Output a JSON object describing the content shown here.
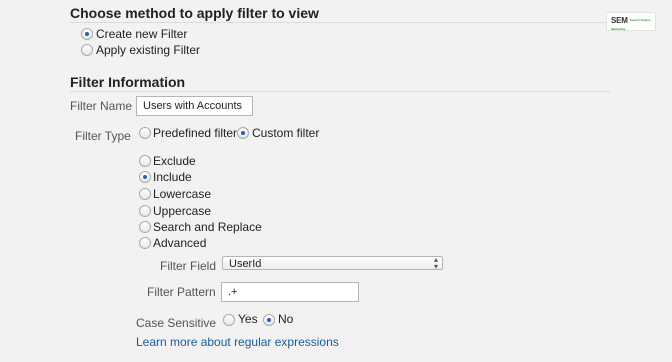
{
  "section_method": {
    "title": "Choose method to apply filter to view",
    "options": [
      {
        "label": "Create new Filter",
        "selected": true
      },
      {
        "label": "Apply existing Filter",
        "selected": false
      }
    ]
  },
  "section_info": {
    "title": "Filter Information",
    "filter_name": {
      "label": "Filter Name",
      "value": "Users with Accounts"
    },
    "filter_type": {
      "label": "Filter Type",
      "options": [
        {
          "label": "Predefined filter",
          "selected": false
        },
        {
          "label": "Custom filter",
          "selected": true
        }
      ]
    },
    "custom_options": [
      {
        "label": "Exclude",
        "selected": false
      },
      {
        "label": "Include",
        "selected": true
      },
      {
        "label": "Lowercase",
        "selected": false
      },
      {
        "label": "Uppercase",
        "selected": false
      },
      {
        "label": "Search and Replace",
        "selected": false
      },
      {
        "label": "Advanced",
        "selected": false
      }
    ],
    "filter_field": {
      "label": "Filter Field",
      "value": "UserId"
    },
    "filter_pattern": {
      "label": "Filter Pattern",
      "value": ".+"
    },
    "case_sensitive": {
      "label": "Case Sensitive",
      "options": [
        {
          "label": "Yes",
          "selected": false
        },
        {
          "label": "No",
          "selected": true
        }
      ]
    },
    "help_link": "Learn more about regular expressions"
  },
  "logo": {
    "text": "SEM",
    "subtext": "Search Engine Marketing"
  },
  "colors": {
    "background": "#f2f2f2",
    "link": "#1a5a9c",
    "radio_dot": "#2c5fb6"
  }
}
